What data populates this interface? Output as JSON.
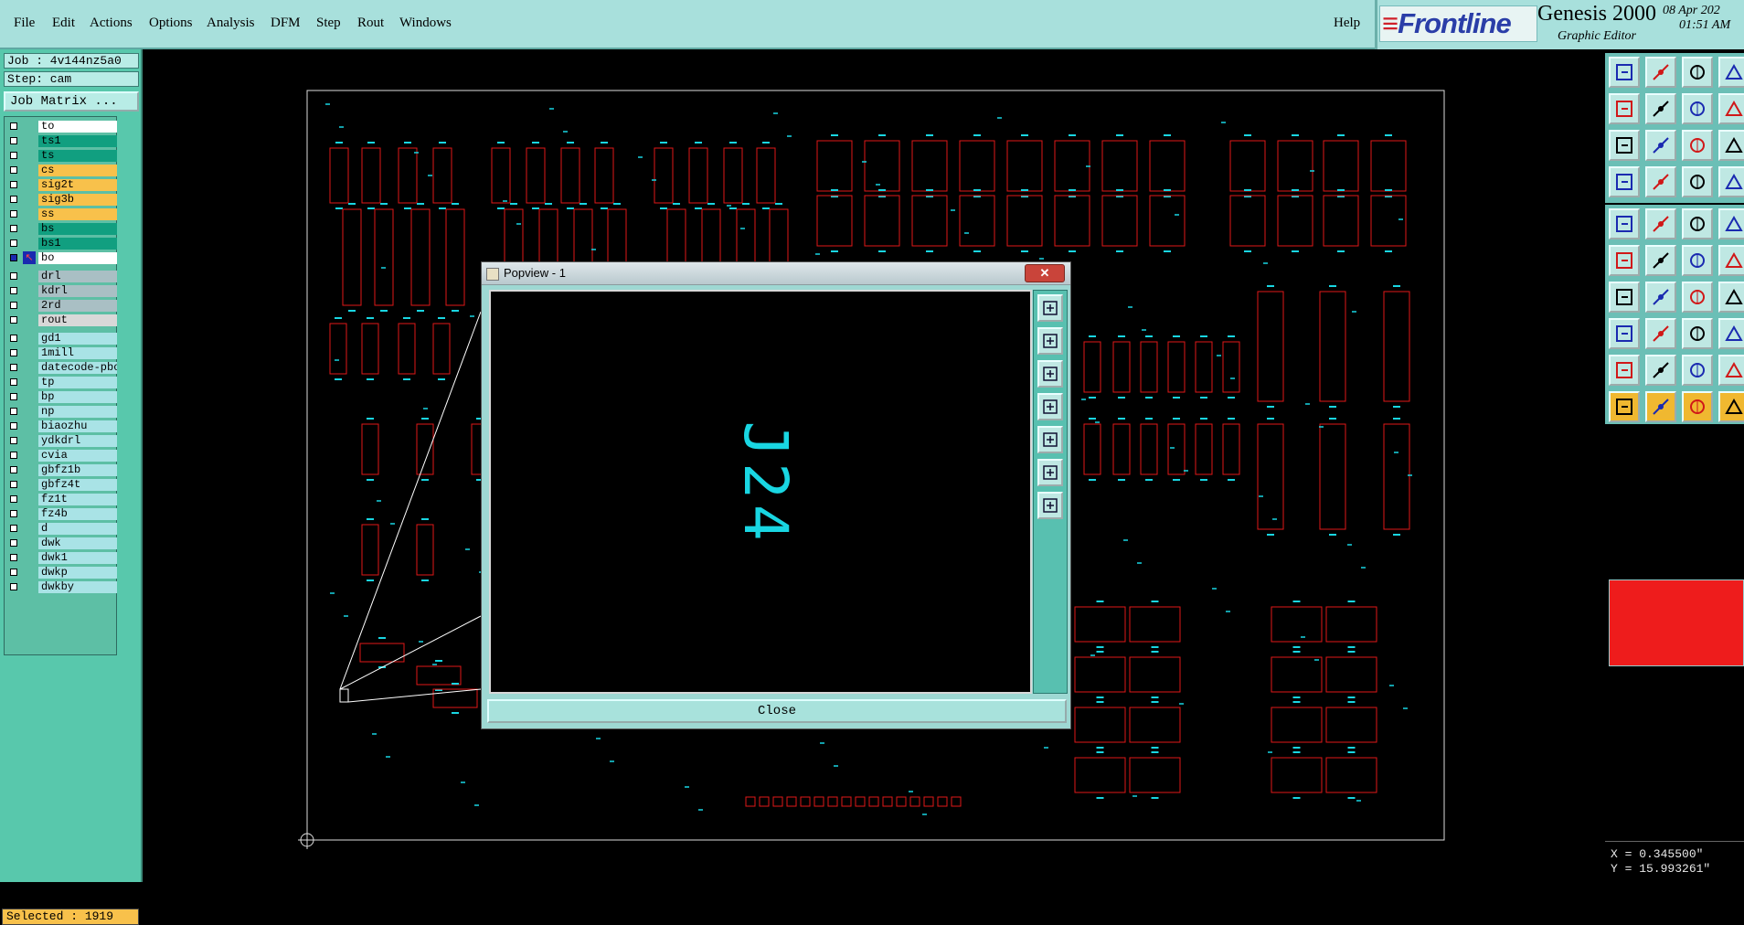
{
  "menubar": {
    "items": [
      "File",
      "Edit",
      "Actions",
      "Options",
      "Analysis",
      "DFM",
      "Step",
      "Rout",
      "Windows"
    ],
    "help": "Help"
  },
  "brand": {
    "logo": "Frontline",
    "product": "Genesis 2000",
    "subtitle": "Graphic Editor",
    "date": "08 Apr 202",
    "time": "01:51 AM"
  },
  "left_panel": {
    "job": "Job : 4v144nz5a0",
    "step": "Step: cam",
    "job_matrix_label": "Job Matrix ...",
    "layers": [
      {
        "name": "to",
        "color": "#ffffff"
      },
      {
        "name": "ts1",
        "color": "#119f80"
      },
      {
        "name": "ts",
        "color": "#119f80"
      },
      {
        "name": "cs",
        "color": "#f8c14b"
      },
      {
        "name": "sig2t",
        "color": "#f8c14b"
      },
      {
        "name": "sig3b",
        "color": "#f8c14b"
      },
      {
        "name": "ss",
        "color": "#f8c14b"
      },
      {
        "name": "bs",
        "color": "#119f80"
      },
      {
        "name": "bs1",
        "color": "#119f80"
      },
      {
        "name": "bo",
        "color": "#ffffff",
        "active": true
      },
      {
        "name": "drl",
        "color": "#a9bfc4"
      },
      {
        "name": "kdrl",
        "color": "#a9bfc4"
      },
      {
        "name": "2rd",
        "color": "#a9bfc4"
      },
      {
        "name": "rout",
        "color": "#d8d8d8"
      },
      {
        "name": "gd1",
        "color": "#a9e3e6"
      },
      {
        "name": "1mill",
        "color": "#a9e3e6"
      },
      {
        "name": "datecode-pbo",
        "color": "#a9e3e6"
      },
      {
        "name": "tp",
        "color": "#a9e3e6"
      },
      {
        "name": "bp",
        "color": "#a9e3e6"
      },
      {
        "name": "np",
        "color": "#a9e3e6"
      },
      {
        "name": "biaozhu",
        "color": "#a9e3e6"
      },
      {
        "name": "ydkdrl",
        "color": "#a9e3e6"
      },
      {
        "name": "cvia",
        "color": "#a9e3e6"
      },
      {
        "name": "gbfz1b",
        "color": "#a9e3e6"
      },
      {
        "name": "gbfz4t",
        "color": "#a9e3e6"
      },
      {
        "name": "fz1t",
        "color": "#a9e3e6"
      },
      {
        "name": "fz4b",
        "color": "#a9e3e6"
      },
      {
        "name": "d",
        "color": "#a9e3e6"
      },
      {
        "name": "dwk",
        "color": "#a9e3e6"
      },
      {
        "name": "dwk1",
        "color": "#a9e3e6"
      },
      {
        "name": "dwkp",
        "color": "#a9e3e6"
      },
      {
        "name": "dwkby",
        "color": "#a9e3e6"
      }
    ],
    "selected": "Selected : 1919"
  },
  "popview": {
    "title": "Popview - 1",
    "close_label": "Close",
    "view_text": "J24",
    "text_color": "#19d6e2"
  },
  "coords": {
    "x": "X = 0.345500\"",
    "y": "Y = 15.993261\""
  },
  "colors": {
    "panel_teal": "#58c8ac",
    "menubar": "#a8e0dc",
    "outline_red": "#e01818",
    "pad_cyan": "#19d6e2"
  }
}
